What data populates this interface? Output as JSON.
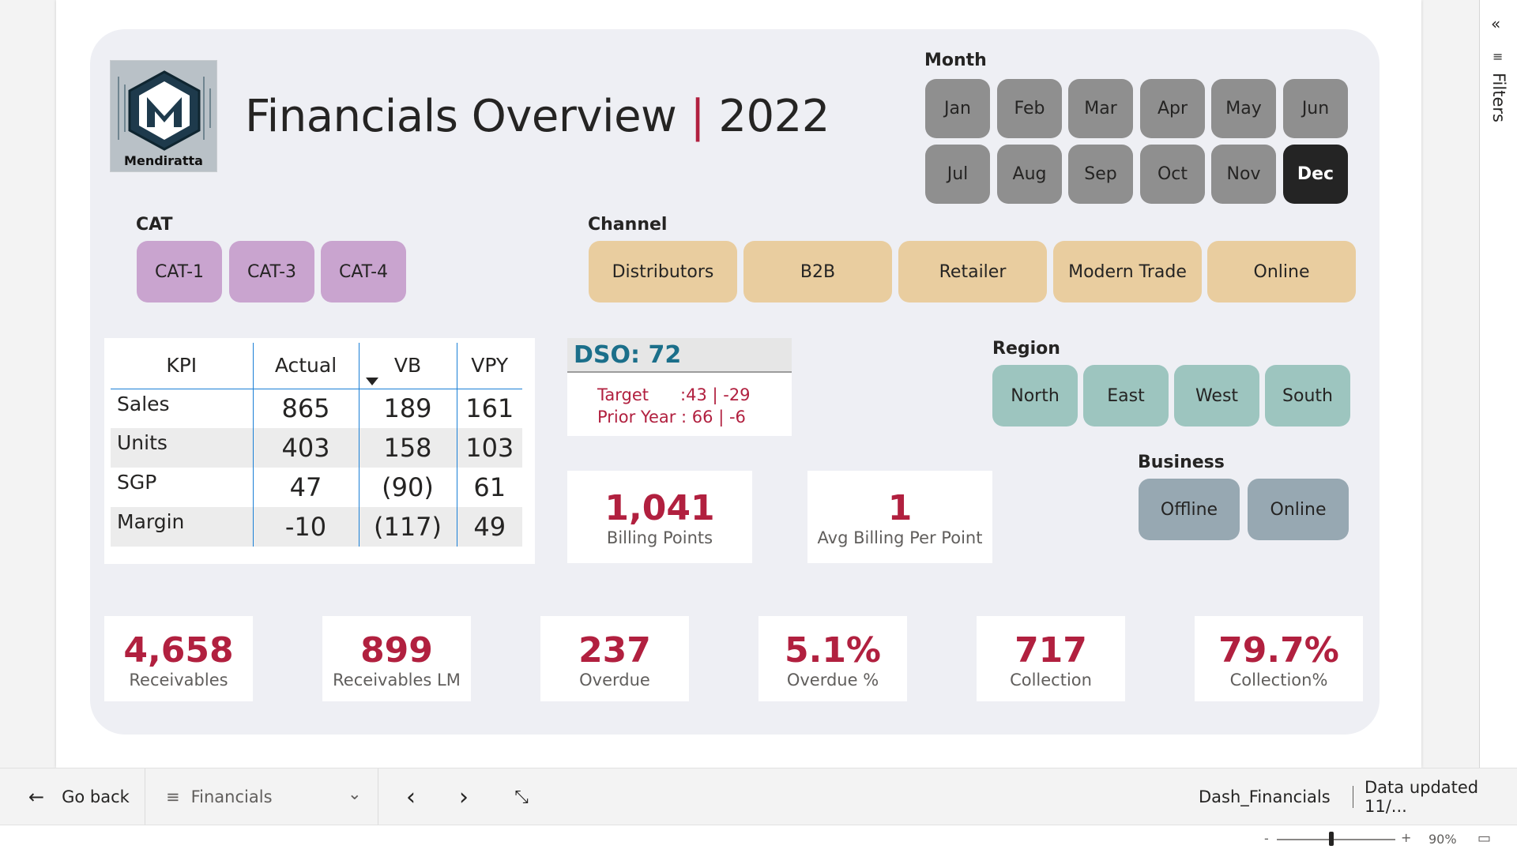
{
  "report": {
    "title_main": "Financials Overview",
    "title_sep": "|",
    "title_year": "2022",
    "logo_text": "Mendiratta"
  },
  "month_slicer": {
    "label": "Month",
    "items": [
      "Jan",
      "Feb",
      "Mar",
      "Apr",
      "May",
      "Jun",
      "Jul",
      "Aug",
      "Sep",
      "Oct",
      "Nov",
      "Dec"
    ],
    "selected": "Dec"
  },
  "cat_slicer": {
    "label": "CAT",
    "items": [
      "CAT-1",
      "CAT-3",
      "CAT-4"
    ]
  },
  "channel_slicer": {
    "label": "Channel",
    "items": [
      "Distributors",
      "B2B",
      "Retailer",
      "Modern Trade",
      "Online"
    ]
  },
  "region_slicer": {
    "label": "Region",
    "items": [
      "North",
      "East",
      "West",
      "South"
    ]
  },
  "business_slicer": {
    "label": "Business",
    "items": [
      "Offline",
      "Online"
    ]
  },
  "kpi_table": {
    "headers": [
      "KPI",
      "Actual",
      "VB",
      "VPY"
    ],
    "rows": [
      [
        "Sales",
        "865",
        "189",
        "161"
      ],
      [
        "Units",
        "403",
        "158",
        "103"
      ],
      [
        "SGP",
        "47",
        "(90)",
        "61"
      ],
      [
        "Margin",
        "-10",
        "(117)",
        "49"
      ]
    ]
  },
  "dso": {
    "title": "DSO: 72",
    "target_line": "Target      :43 | -29",
    "prior_line": "Prior Year : 66 | -6"
  },
  "cards_mid": [
    {
      "value": "1,041",
      "label": "Billing Points"
    },
    {
      "value": "1",
      "label": "Avg Billing Per Point"
    }
  ],
  "cards_bottom": [
    {
      "value": "4,658",
      "label": "Receivables"
    },
    {
      "value": "899",
      "label": "Receivables LM"
    },
    {
      "value": "237",
      "label": "Overdue"
    },
    {
      "value": "5.1%",
      "label": "Overdue %"
    },
    {
      "value": "717",
      "label": "Collection"
    },
    {
      "value": "79.7%",
      "label": "Collection%"
    }
  ],
  "filters_pane": {
    "label": "Filters",
    "collapse_glyph": "«",
    "icon_glyph": "≡"
  },
  "bottom_bar": {
    "go_back": "Go back",
    "back_glyph": "←",
    "page_glyph": "≡",
    "page_name": "Financials",
    "page_chevron": "⌄",
    "prev_glyph": "‹",
    "next_glyph": "›",
    "focus_glyph": "⤡",
    "report_name": "Dash_Financials",
    "data_updated": "Data updated 11/..."
  },
  "status_bar": {
    "zoom_minus": "-",
    "zoom_plus": "+",
    "zoom_level": "90%",
    "zoom_level_pct": 90,
    "fit_glyph": "▭"
  },
  "colors": {
    "accent_red": "#b1203f",
    "month_btn": "#8f8f8f",
    "month_selected": "#242424",
    "cat_btn": "#c9a4cf",
    "channel_btn": "#e9cd9f",
    "region_btn": "#9dc5bf",
    "business_btn": "#97a8b2",
    "dso_title": "#1b6f8a"
  }
}
